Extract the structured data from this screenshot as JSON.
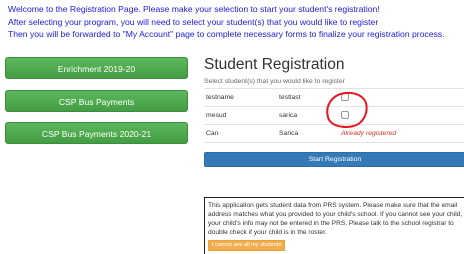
{
  "intro": {
    "line1": "Welcome to the Registration Page. Please make your selection to start your student's registration!",
    "line2": "After selecting your program, you will need to select your student(s) that you would like to register",
    "line3": "Then you will be forwarded to \"My Account\" page to complete necessary forms to finalize your registration process."
  },
  "programs": [
    {
      "label": "Enrichment 2019-20"
    },
    {
      "label": "CSP Bus Payments"
    },
    {
      "label": "CSP Bus Payments 2020-21"
    }
  ],
  "registration": {
    "title": "Student Registration",
    "subtitle": "Select student(s) that you would like to register",
    "students": [
      {
        "first": "testname",
        "last": "testlast",
        "checked": false,
        "status": ""
      },
      {
        "first": "mesud",
        "last": "sarica",
        "checked": false,
        "status": ""
      },
      {
        "first": "Can",
        "last": "Sarica",
        "status": "Already registered"
      }
    ],
    "start_label": "Start Registration"
  },
  "notice": {
    "text": "This application gets student data from PRS system. Please make sure that the email address matches what you provided to your child's school. If you cannot see your child, your child's info may not be entered in the PRS. Please talk to the school registrar to double check if your child is in the roster.",
    "button_label": "I cannot see all my students"
  },
  "colors": {
    "intro_text": "#1a1ae6",
    "program_button": "#5cb85c",
    "primary_button": "#337ab7",
    "status_text": "#d9342b",
    "annotation": "#e8141d",
    "notice_button": "#f0ad4e"
  }
}
